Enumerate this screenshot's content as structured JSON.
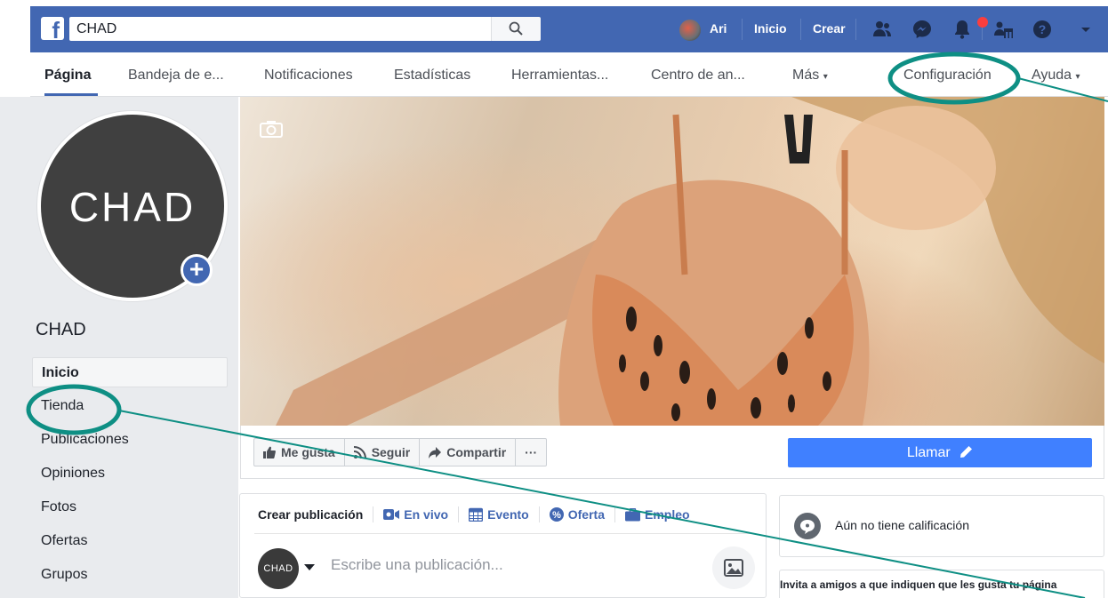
{
  "topbar": {
    "search_value": "CHAD",
    "user_name": "Ari",
    "home_label": "Inicio",
    "create_label": "Crear"
  },
  "pagenav": {
    "items": [
      "Página",
      "Bandeja de e...",
      "Notificaciones",
      "Estadísticas",
      "Herramientas...",
      "Centro de an...",
      "Más",
      "Configuración",
      "Ayuda"
    ]
  },
  "profile": {
    "avatar_text": "CHAD",
    "page_name": "CHAD"
  },
  "sidebar": {
    "items": [
      "Inicio",
      "Tienda",
      "Publicaciones",
      "Opiniones",
      "Fotos",
      "Ofertas",
      "Grupos"
    ]
  },
  "actions": {
    "like_label": "Me gusta",
    "follow_label": "Seguir",
    "share_label": "Compartir",
    "more_label": "···",
    "call_label": "Llamar"
  },
  "composer": {
    "tabs": [
      "Crear publicación",
      "En vivo",
      "Evento",
      "Oferta",
      "Empleo"
    ],
    "avatar_text": "CHAD",
    "placeholder": "Escribe una publicación..."
  },
  "rating": {
    "text": "Aún no tiene calificación"
  },
  "invite": {
    "text": "Invita a amigos a que indiquen que les gusta tu página"
  },
  "colors": {
    "brand_blue": "#4267b2",
    "call_blue": "#4080ff",
    "annotation_teal": "#0e8f84",
    "notification_red": "#fa3e3e"
  }
}
